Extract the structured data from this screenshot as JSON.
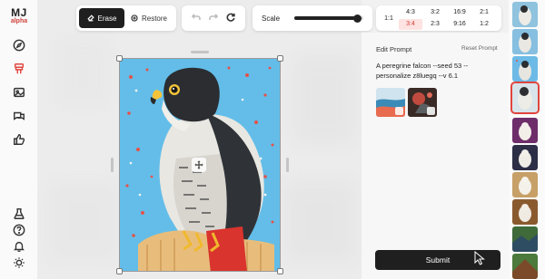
{
  "app": {
    "logo_text": "MJ",
    "logo_subtext": "alpha"
  },
  "sidebar": {
    "icons": [
      "explore-icon",
      "create-icon",
      "gallery-icon",
      "chat-icon",
      "likes-icon",
      "lab-icon",
      "help-icon",
      "notifications-icon",
      "theme-icon"
    ],
    "active": "create-icon"
  },
  "toolbar": {
    "erase_label": "Erase",
    "restore_label": "Restore",
    "scale_label": "Scale",
    "scale_value": 0.92,
    "ratio_square": "1:1",
    "ratios": [
      "4:3",
      "3:2",
      "16:9",
      "2:1",
      "3:4",
      "2:3",
      "9:16",
      "1:2"
    ],
    "selected_ratio": "3:4"
  },
  "panel": {
    "title": "Edit Prompt",
    "reset_label": "Reset Prompt",
    "prompt_text": "A peregrine falcon --seed 53 --personalize z8luegq --v 6.1",
    "submit_label": "Submit"
  },
  "colors": {
    "accent": "#e0463e",
    "dark": "#1f1f1f",
    "selected_ratio_bg": "#fde3e1"
  }
}
